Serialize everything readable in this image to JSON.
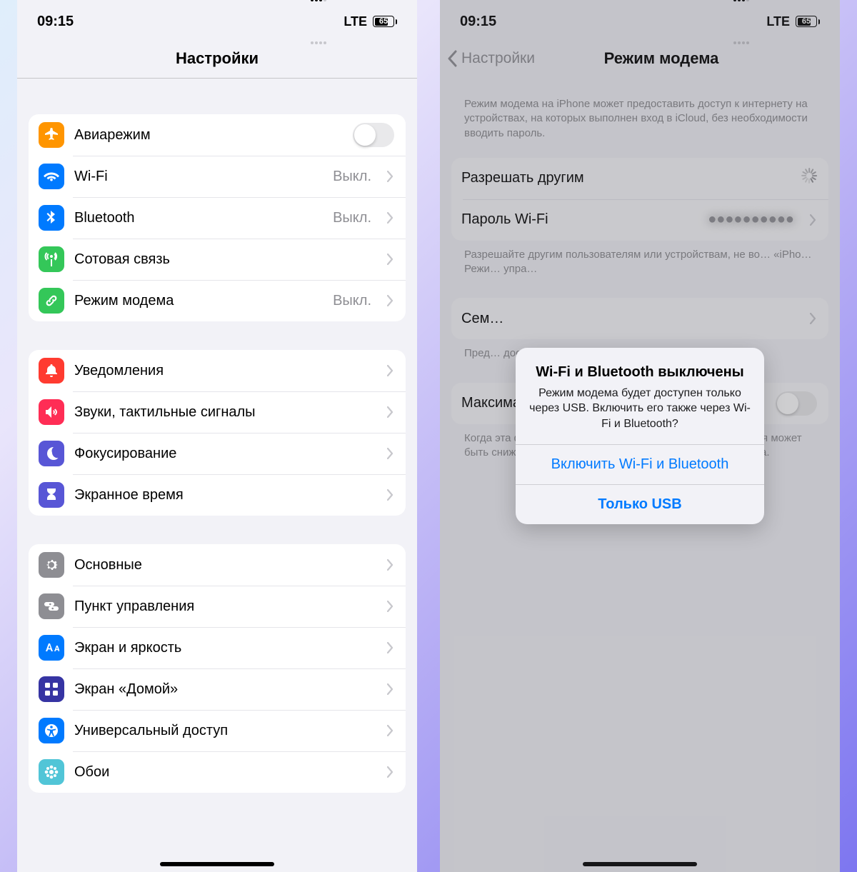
{
  "status": {
    "time": "09:15",
    "carrier": "LTE",
    "battery_pct": 65
  },
  "left": {
    "title": "Настройки",
    "group1": [
      {
        "key": "airplane",
        "label": "Авиарежим",
        "icon": "airplane-icon",
        "bg": "#ff9500",
        "toggle": true
      },
      {
        "key": "wifi",
        "label": "Wi-Fi",
        "value": "Выкл.",
        "icon": "wifi-icon",
        "bg": "#007aff"
      },
      {
        "key": "bluetooth",
        "label": "Bluetooth",
        "value": "Выкл.",
        "icon": "bluetooth-icon",
        "bg": "#007aff"
      },
      {
        "key": "cellular",
        "label": "Сотовая связь",
        "icon": "antenna-icon",
        "bg": "#34c759"
      },
      {
        "key": "hotspot",
        "label": "Режим модема",
        "value": "Выкл.",
        "icon": "link-icon",
        "bg": "#34c759"
      }
    ],
    "group2": [
      {
        "key": "notifications",
        "label": "Уведомления",
        "icon": "bell-icon",
        "bg": "#ff3b30"
      },
      {
        "key": "sounds",
        "label": "Звуки, тактильные сигналы",
        "icon": "speaker-icon",
        "bg": "#ff2d55"
      },
      {
        "key": "focus",
        "label": "Фокусирование",
        "icon": "moon-icon",
        "bg": "#5856d6"
      },
      {
        "key": "screentime",
        "label": "Экранное время",
        "icon": "hourglass-icon",
        "bg": "#5856d6"
      }
    ],
    "group3": [
      {
        "key": "general",
        "label": "Основные",
        "icon": "gear-icon",
        "bg": "#8e8e93"
      },
      {
        "key": "controlcenter",
        "label": "Пункт управления",
        "icon": "switches-icon",
        "bg": "#8e8e93"
      },
      {
        "key": "display",
        "label": "Экран и яркость",
        "icon": "textsize-icon",
        "bg": "#007aff"
      },
      {
        "key": "homescreen",
        "label": "Экран «Домой»",
        "icon": "grid-icon",
        "bg": "#3634a3"
      },
      {
        "key": "accessibility",
        "label": "Универсальный доступ",
        "icon": "accessibility-icon",
        "bg": "#007aff"
      },
      {
        "key": "wallpaper",
        "label": "Обои",
        "icon": "flower-icon",
        "bg": "#51c5d7"
      }
    ]
  },
  "right": {
    "back": "Настройки",
    "title": "Режим модема",
    "intro": "Режим модема на iPhone может предоставить доступ к интернету на устройствах, на которых выполнен вход в iCloud, без необходимости вводить пароль.",
    "rows1": [
      {
        "key": "allow_others",
        "label": "Разрешать другим",
        "loading": true
      },
      {
        "key": "wifi_password",
        "label": "Пароль Wi-Fi",
        "value_redacted": true
      }
    ],
    "note1_partial": "Разрешайте другим пользователям или устройствам, не во… «iPho… Режи… упра…",
    "rows2": [
      {
        "key": "family",
        "label": "Сем…"
      }
    ],
    "note2_partial": "Пред… доста…",
    "rows3": [
      {
        "key": "maxcompat",
        "label": "Максимальная совместимость",
        "toggle": false
      }
    ],
    "note3": "Когда эта функция включена, скорость интернет-соединения может быть снижена для устройств, подключенных к точке доступа.",
    "alert": {
      "title": "Wi-Fi и Bluetooth выключены",
      "message": "Режим модема будет доступен только через USB. Включить его также через Wi-Fi и Bluetooth?",
      "primary": "Включить Wi-Fi и Bluetooth",
      "secondary": "Только USB"
    }
  }
}
